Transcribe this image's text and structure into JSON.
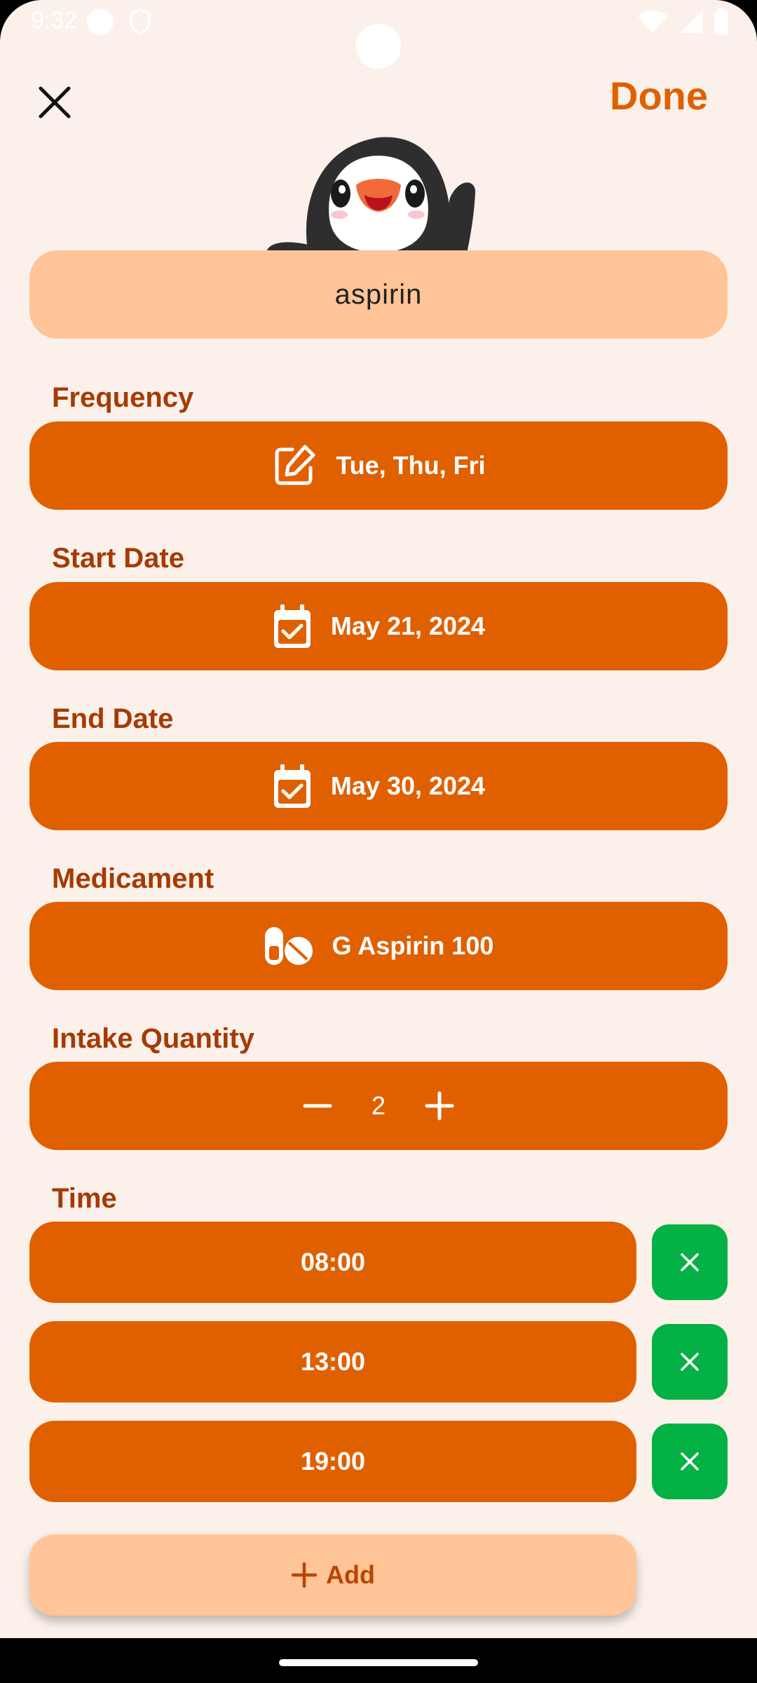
{
  "status": {
    "time": "9:32"
  },
  "header": {
    "done_label": "Done"
  },
  "medication_name": "aspirin",
  "frequency": {
    "label": "Frequency",
    "value": "Tue, Thu, Fri"
  },
  "start_date": {
    "label": "Start Date",
    "value": "May 21, 2024"
  },
  "end_date": {
    "label": "End Date",
    "value": "May 30, 2024"
  },
  "medicament": {
    "label": "Medicament",
    "value": "G Aspirin 100"
  },
  "intake": {
    "label": "Intake Quantity",
    "value": "2"
  },
  "time": {
    "label": "Time",
    "entries": [
      "08:00",
      "13:00",
      "19:00"
    ]
  },
  "add_label": "Add",
  "colors": {
    "background": "#fcf1ea",
    "accent": "#e06000",
    "accent_light": "#ffc497",
    "label": "#a63a05",
    "remove": "#04b144"
  }
}
